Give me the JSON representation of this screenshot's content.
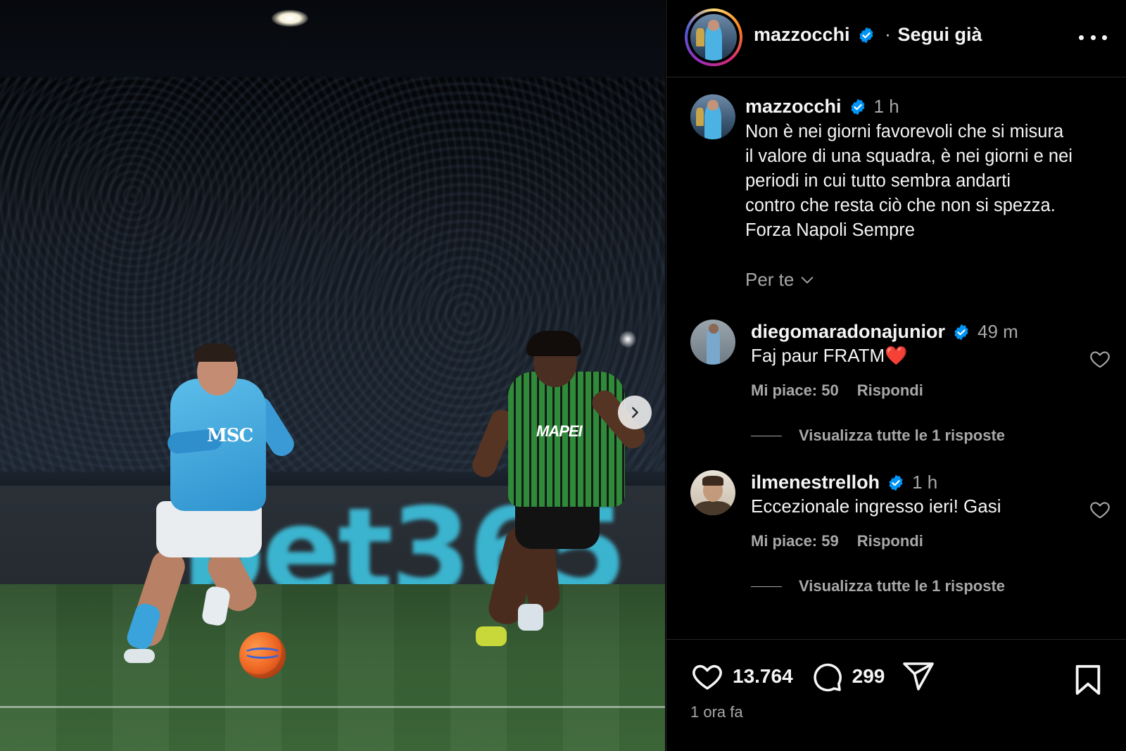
{
  "post": {
    "author": "mazzocchi",
    "follow_status": "Segui già",
    "separator": "·"
  },
  "caption": {
    "author": "mazzocchi",
    "time": "1 h",
    "text": "Non è nei giorni favorevoli che si misura\nil valore di una squadra, è nei giorni e nei\nperiodi in cui tutto sembra andarti\ncontro che resta ciò che non si spezza.\nForza Napoli Sempre"
  },
  "filter": {
    "label": "Per te",
    "icon": "chevron-down-icon"
  },
  "comments": [
    {
      "user": "diegomaradonajunior",
      "time": "49 m",
      "text": "Faj paur FRATM❤️",
      "likes": "Mi piace: 50",
      "reply": "Rispondi",
      "view_replies": "Visualizza tutte le 1 risposte"
    },
    {
      "user": "ilmenestrelloh",
      "time": "1 h",
      "text": "Eccezionale ingresso ieri! Gasi",
      "likes": "Mi piace: 59",
      "reply": "Rispondi",
      "view_replies": "Visualizza tutte le 1 risposte"
    }
  ],
  "actions": {
    "likes_count": "13.764",
    "comments_count": "299",
    "posted_ago": "1 ora fa"
  },
  "photo": {
    "shirt_sponsor_left": "MSC",
    "shirt_sponsor_right": "MAPEI",
    "board_text": "bet365"
  },
  "colors": {
    "background": "#000000",
    "text_primary": "#f5f5f5",
    "text_secondary": "#a8a8a8",
    "verified_blue": "#0095f6"
  }
}
